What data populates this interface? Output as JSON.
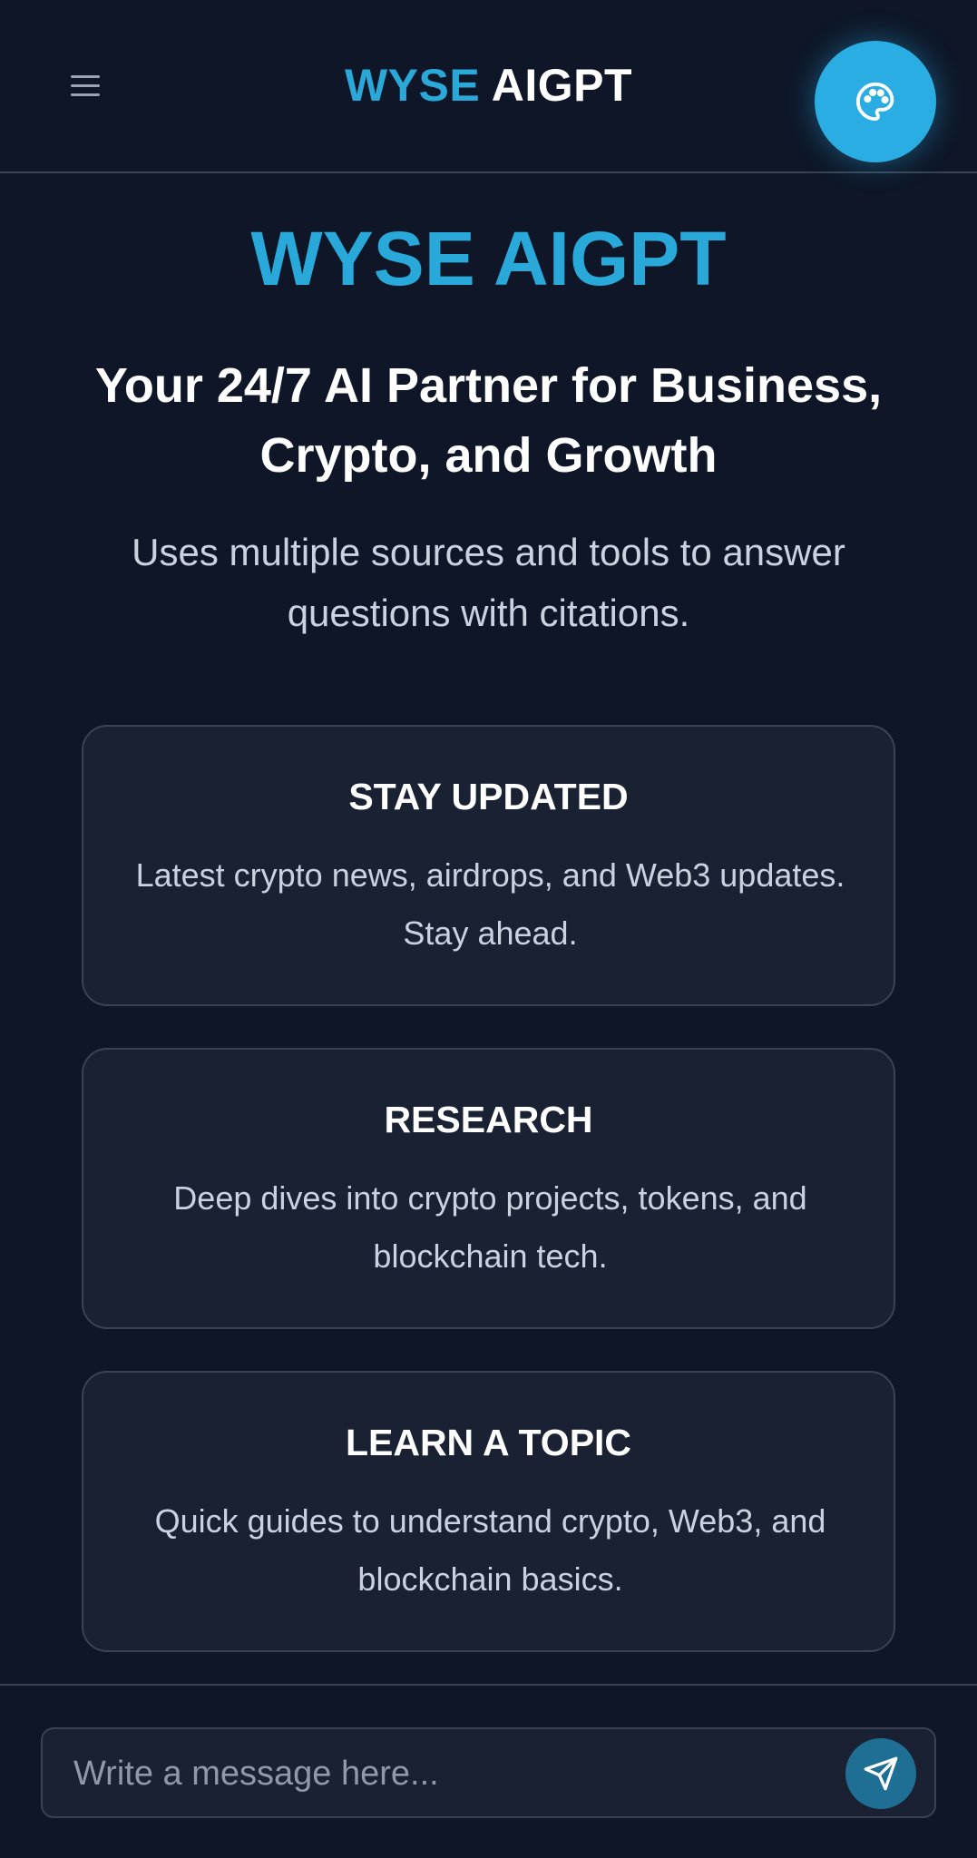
{
  "header": {
    "menu_icon": "hamburger-menu-icon",
    "brand_accent": "WYSE",
    "brand_rest": "AIGPT",
    "theme_icon": "palette-icon"
  },
  "hero": {
    "title": "WYSE AIGPT",
    "subtitle": "Your 24/7 AI Partner for Business, Crypto, and Growth",
    "description": "Uses multiple sources and tools to answer questions with citations."
  },
  "cards": [
    {
      "title": "STAY UPDATED",
      "description": "Latest crypto news, airdrops, and Web3 updates. Stay ahead."
    },
    {
      "title": "RESEARCH",
      "description": "Deep dives into crypto projects, tokens, and blockchain tech."
    },
    {
      "title": "LEARN A TOPIC",
      "description": "Quick guides to understand crypto, Web3, and blockchain basics."
    }
  ],
  "composer": {
    "placeholder": "Write a message here...",
    "value": "",
    "send_icon": "send-paper-plane-icon"
  },
  "colors": {
    "background": "#0e1627",
    "card": "#1a2133",
    "accent": "#29ade2",
    "send_button": "#1f6e94"
  }
}
